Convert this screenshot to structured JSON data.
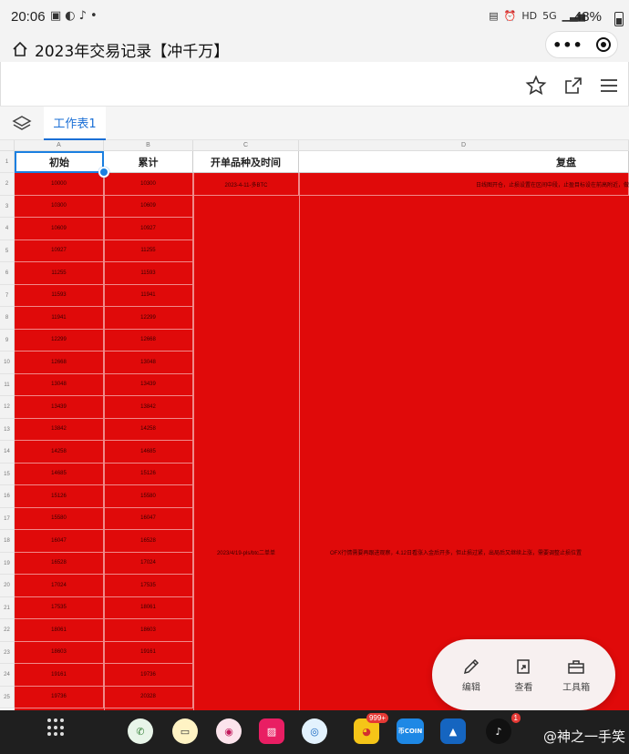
{
  "status_bar": {
    "time": "20:06",
    "battery": "48%",
    "network": "5G",
    "hd": "HD"
  },
  "app": {
    "title": "2023年交易记录【冲千万】"
  },
  "sheet": {
    "tab_label": "工作表1",
    "column_letters": [
      "A",
      "B",
      "C",
      "D"
    ],
    "headers": [
      "初始",
      "累计",
      "开单品种及时间",
      "复盘"
    ],
    "row_numbers": [
      "1",
      "2",
      "3",
      "4",
      "5",
      "6",
      "7",
      "8",
      "9",
      "10",
      "11",
      "12",
      "13",
      "14",
      "15",
      "16",
      "17",
      "18",
      "19",
      "20",
      "21",
      "22",
      "23",
      "24",
      "25"
    ],
    "col_a": [
      "10000",
      "10300",
      "10609",
      "10927",
      "11255",
      "11593",
      "11941",
      "12299",
      "12668",
      "13048",
      "13439",
      "13842",
      "14258",
      "14685",
      "15126",
      "15580",
      "16047",
      "16528",
      "17024",
      "17535",
      "18061",
      "18603",
      "19161",
      "19736"
    ],
    "col_b": [
      "10300",
      "10609",
      "10927",
      "11255",
      "11593",
      "11941",
      "12299",
      "12668",
      "13048",
      "13439",
      "13842",
      "14258",
      "14685",
      "15126",
      "15580",
      "16047",
      "16528",
      "17024",
      "17535",
      "18061",
      "18603",
      "19161",
      "19736",
      "20328"
    ],
    "c_row2": "2023-4-11-多BTC",
    "c_merged": "2023/4/19-pls/btc二单单",
    "d_row2": "日线图开仓，止损设置在区间中段，止盈目标设在前高附近，做完这单",
    "d_merged": "OFX行情需要再跟进观察，4.12日看涨入金后开多，但止损过紧，出局后又继续上涨，需要调整止损位置"
  },
  "fab": {
    "edit": "编辑",
    "view": "查看",
    "tools": "工具箱"
  },
  "taskbar": {
    "badge_weibo": "999+",
    "badge_tiktok": "1",
    "coin_label": "币COIN",
    "watermark": "@神之一手笑"
  },
  "colors": {
    "red_fill": "#e00a0a",
    "accent": "#1a6fd6"
  }
}
